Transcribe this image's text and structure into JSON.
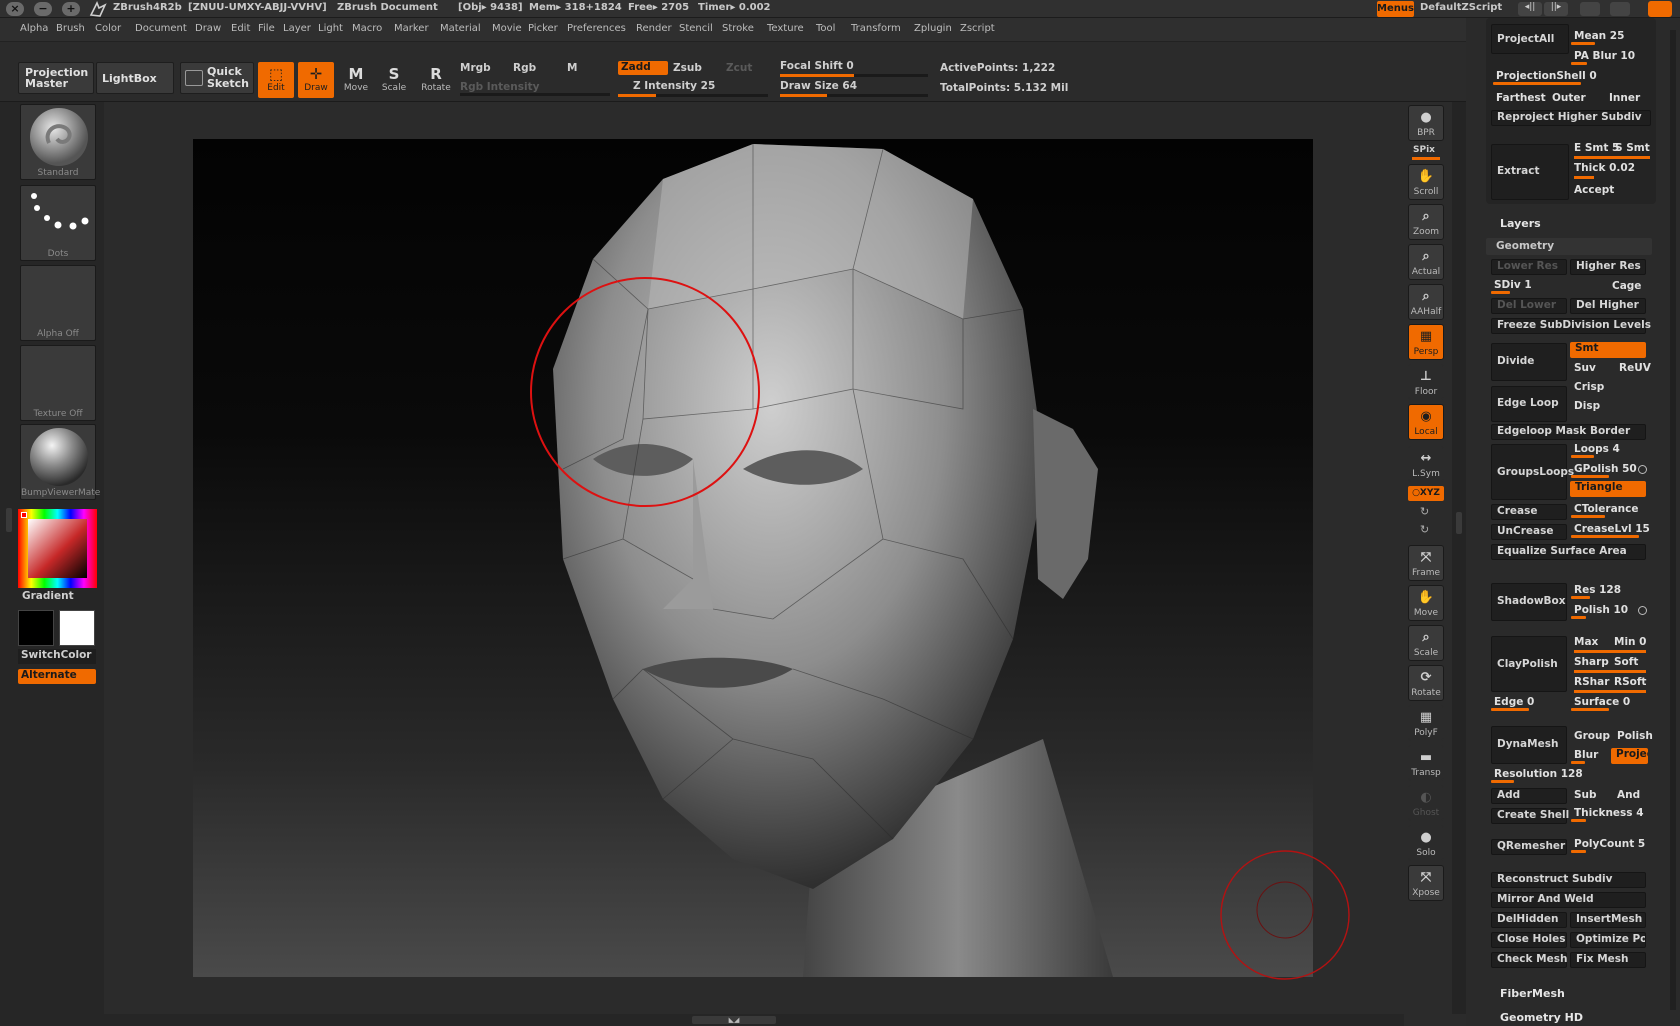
{
  "titlebar": {
    "app": "ZBrush4R2b",
    "license": "[ZNUU-UMXY-ABJJ-VVHV]",
    "document": "ZBrush Document",
    "obj": "[Obj▸ 9438]",
    "mem": "Mem▸ 318+1824",
    "free": "Free▸ 2705",
    "timer": "Timer▸ 0.002",
    "menus_btn": "Menus",
    "script": "DefaultZScript"
  },
  "menubar": [
    "Alpha",
    "Brush",
    "Color",
    "Document",
    "Draw",
    "Edit",
    "File",
    "Layer",
    "Light",
    "Macro",
    "Marker",
    "Material",
    "Movie",
    "Picker",
    "Preferences",
    "Render",
    "Stencil",
    "Stroke",
    "Texture",
    "Tool",
    "Transform",
    "Zplugin",
    "Zscript"
  ],
  "topshelf": {
    "projection_master": "Projection Master",
    "lightbox": "LightBox",
    "quick_sketch": "Quick Sketch",
    "edit": "Edit",
    "draw": "Draw",
    "move": "Move",
    "scale": "Scale",
    "rotate": "Rotate",
    "mrgb": "Mrgb",
    "rgb": "Rgb",
    "m": "M",
    "rgb_intensity": "Rgb Intensity",
    "zadd": "Zadd",
    "zsub": "Zsub",
    "zcut": "Zcut",
    "z_intensity": "Z Intensity 25",
    "z_intensity_value": 25,
    "focal_shift": "Focal Shift 0",
    "draw_size": "Draw Size 64",
    "draw_size_value": 64,
    "active_points": "ActivePoints: 1,222",
    "total_points": "TotalPoints: 5.132 Mil"
  },
  "leftpanel": {
    "brush": "Standard",
    "stroke": "Dots",
    "alpha": "Alpha  Off",
    "texture": "Texture  Off",
    "material": "BumpViewerMate",
    "gradient": "Gradient",
    "switchcolor": "SwitchColor",
    "alternate": "Alternate",
    "accent": "#f06a00"
  },
  "rightshelf": [
    {
      "label": "BPR",
      "icon": "bpr-icon"
    },
    {
      "label": "SPix",
      "icon": "spix-slider"
    },
    {
      "label": "Scroll",
      "icon": "scroll-icon"
    },
    {
      "label": "Zoom",
      "icon": "zoom-icon"
    },
    {
      "label": "Actual",
      "icon": "actual-icon"
    },
    {
      "label": "AAHalf",
      "icon": "aahalf-icon"
    },
    {
      "label": "Persp",
      "icon": "persp-icon"
    },
    {
      "label": "Floor",
      "icon": "floor-icon"
    },
    {
      "label": "Local",
      "icon": "local-icon"
    },
    {
      "label": "L.Sym",
      "icon": "lsym-icon"
    },
    {
      "label": "○XYZ",
      "icon": "xyz-icon"
    },
    {
      "label": "Frame",
      "icon": "frame-icon"
    },
    {
      "label": "Move",
      "icon": "move-icon"
    },
    {
      "label": "Scale",
      "icon": "scale-icon"
    },
    {
      "label": "Rotate",
      "icon": "rotate-icon"
    },
    {
      "label": "PolyF",
      "icon": "polyf-icon"
    },
    {
      "label": "Transp",
      "icon": "transp-icon"
    },
    {
      "label": "Ghost",
      "icon": "ghost-icon"
    },
    {
      "label": "Solo",
      "icon": "solo-icon"
    },
    {
      "label": "Xpose",
      "icon": "xpose-icon"
    }
  ],
  "panel": {
    "projectall": "ProjectAll",
    "mean": "Mean 25",
    "pa_blur": "PA Blur 10",
    "projectionshell": "ProjectionShell 0",
    "farthest": "Farthest",
    "outer": "Outer",
    "inner": "Inner",
    "reproject": "Reproject Higher Subdiv",
    "extract": "Extract",
    "e_smt": "E Smt 5",
    "s_smt": "S Smt",
    "thick": "Thick 0.02",
    "accept": "Accept",
    "layers": "Layers",
    "geometry": "Geometry",
    "lower_res": "Lower Res",
    "higher_res": "Higher Res",
    "sdiv": "SDiv 1",
    "cage": "Cage",
    "del_lower": "Del Lower",
    "del_higher": "Del Higher",
    "freeze": "Freeze SubDivision Levels",
    "divide": "Divide",
    "smt": "Smt",
    "suv": "Suv",
    "reuv": "ReUV",
    "edge_loop": "Edge Loop",
    "crisp": "Crisp",
    "disp": "Disp",
    "edgeloop_mask_border": "Edgeloop Mask Border",
    "groupsloops": "GroupsLoops",
    "loops": "Loops 4",
    "gpolish": "GPolish 50",
    "triangle": "Triangle",
    "crease": "Crease",
    "ctolerance": "CTolerance",
    "uncrease": "UnCrease",
    "creaselvl": "CreaseLvl 15",
    "equalize": "Equalize Surface Area",
    "shadowbox": "ShadowBox",
    "res": "Res 128",
    "polish": "Polish 10",
    "claypolish": "ClayPolish",
    "max": "Max",
    "min": "Min 0",
    "sharp": "Sharp",
    "soft": "Soft",
    "rsharp": "RShar",
    "rsoft": "RSoft",
    "edge": "Edge 0",
    "surface": "Surface 0",
    "dynamesh": "DynaMesh",
    "group": "Group",
    "polish2": "Polish",
    "blur": "Blur",
    "project": "Projec",
    "resolution": "Resolution 128",
    "add": "Add",
    "sub": "Sub",
    "and": "And",
    "create_shell": "Create Shell",
    "thickness": "Thickness 4",
    "qremesher": "QRemesher",
    "polycount": "PolyCount 5",
    "reconstruct": "Reconstruct Subdiv",
    "mirror_weld": "Mirror And Weld",
    "delhidden": "DelHidden",
    "insertmesh": "InsertMesh",
    "close_holes": "Close Holes",
    "optimize": "Optimize Poi",
    "check_mesh": "Check Mesh",
    "fix_mesh": "Fix Mesh",
    "fibermesh": "FiberMesh",
    "geometry_hd": "Geometry HD"
  }
}
